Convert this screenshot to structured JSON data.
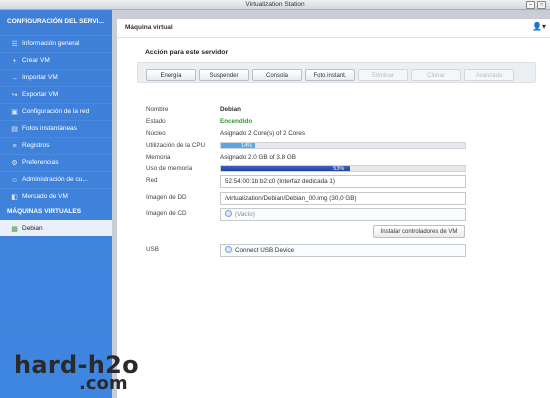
{
  "window": {
    "title": "Virtualization Station",
    "controls": [
      "–",
      "□"
    ]
  },
  "sidebar": {
    "section1": "CONFIGURACIÓN DEL SERVI...",
    "items1": [
      {
        "label": "Información general",
        "icon": "list-icon"
      },
      {
        "label": "Crear VM",
        "icon": "plus-icon"
      },
      {
        "label": "Importar VM",
        "icon": "import-icon"
      },
      {
        "label": "Exportar VM",
        "icon": "export-icon"
      },
      {
        "label": "Configuración de la red",
        "icon": "network-icon"
      },
      {
        "label": "Fotos instantáneas",
        "icon": "snapshot-icon"
      },
      {
        "label": "Registros",
        "icon": "log-icon"
      },
      {
        "label": "Preferencias",
        "icon": "preferences-icon"
      },
      {
        "label": "Administración de cu...",
        "icon": "users-icon"
      },
      {
        "label": "Mercado de VM",
        "icon": "market-icon"
      }
    ],
    "section2": "MÁQUINAS VIRTUALES",
    "items2": [
      {
        "label": "Debian",
        "icon": "vm-icon"
      }
    ]
  },
  "main": {
    "title": "Máquina virtual",
    "actions_title": "Acción para este servidor",
    "buttons": [
      {
        "label": "Energía",
        "enabled": true
      },
      {
        "label": "Suspender",
        "enabled": true
      },
      {
        "label": "Consola",
        "enabled": true
      },
      {
        "label": "Foto instant.",
        "enabled": true
      },
      {
        "label": "Eliminar",
        "enabled": false
      },
      {
        "label": "Clonar",
        "enabled": false
      },
      {
        "label": "Avanzado",
        "enabled": false
      }
    ],
    "details": {
      "name_label": "Nombre",
      "name_value": "Debian",
      "state_label": "Estado",
      "state_value": "Encendido",
      "core_label": "Núcleo",
      "core_value": "Asignado 2 Core(s) of 2 Cores",
      "cpu_label": "Utilización de la CPU",
      "cpu_text": "14%",
      "cpu_percent": 14,
      "memory_label": "Memoria",
      "memory_value": "Asignado 2.0 GB of 3.8 GB",
      "mem_use_label": "Uso de memoria",
      "mem_use_text": "53%",
      "mem_use_percent": 53,
      "network_label": "Red",
      "network_value": "52:54:00:1b:b2:c0 (Interfaz dedicada 1)",
      "hdd_label": "Imagen de DD",
      "hdd_value": "/virtualization/Debian/Debian_00.img (30,0 GB)",
      "cd_label": "Imagen de CD",
      "cd_value": "(Vacío)",
      "install_button": "Instalar controladores de VM",
      "usb_label": "USB",
      "usb_value": "Connect USB Device"
    }
  },
  "colors": {
    "sidebar": "#3f84dd",
    "cpu_bar": "#5aa6e6",
    "mem_bar": "#2a4fa8",
    "state_green": "#2e9a2e"
  },
  "watermark": {
    "line1": "hard-h2o",
    "line2": ".com"
  }
}
